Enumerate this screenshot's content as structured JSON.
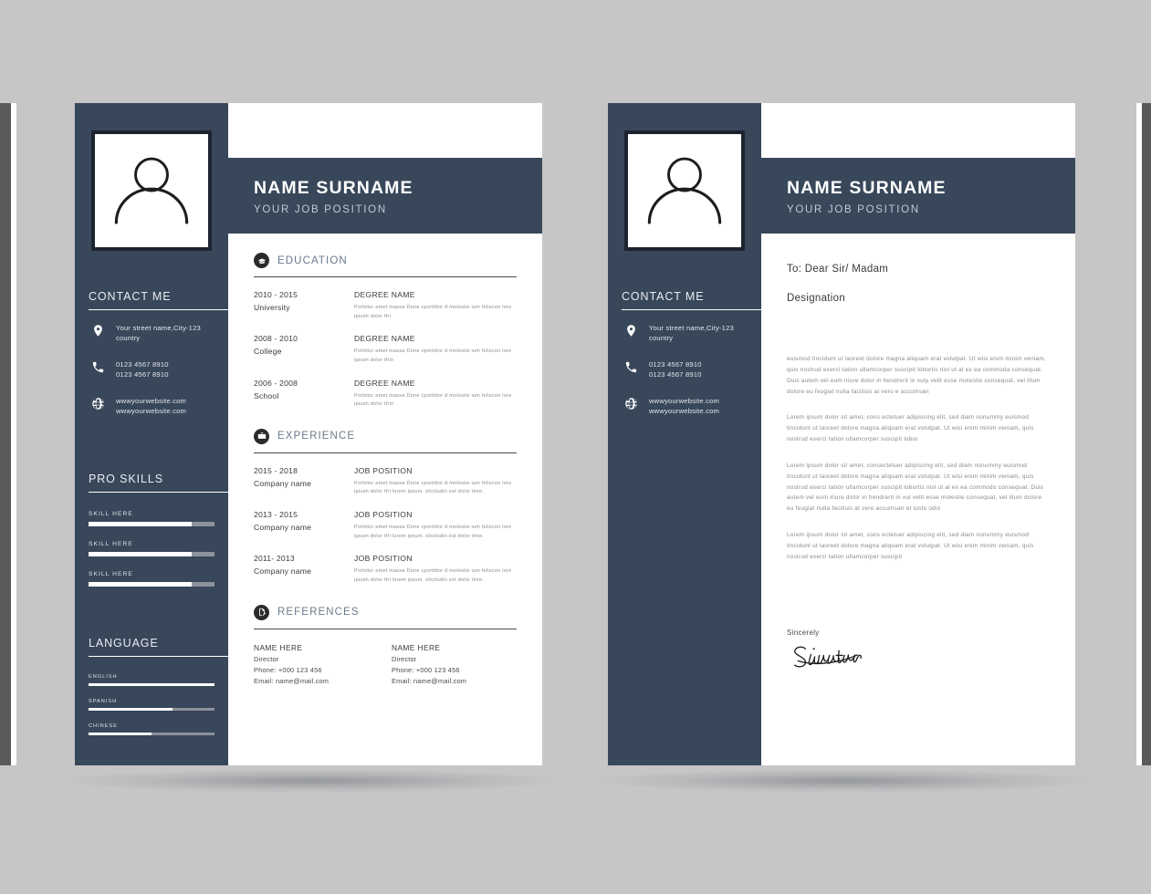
{
  "theme": {
    "navy": "#38475a",
    "page_bg": "#c6c6c6",
    "paper": "#ffffff",
    "section_heading": "#6a7a8d",
    "bar_track": "#8d929b",
    "bar_fill": "#ffffff",
    "body_text": "#8a8a8a"
  },
  "header": {
    "name": "NAME SURNAME",
    "job_position": "YOUR JOB POSITION"
  },
  "sidebar": {
    "avatar_icon": "person-avatar-icon",
    "contact": {
      "title": "CONTACT ME",
      "items": [
        {
          "icon": "location-pin-icon",
          "line1": "Your street name,City-123",
          "line2": "country"
        },
        {
          "icon": "phone-icon",
          "line1": "0123 4567 8910",
          "line2": "0123 4567 8910"
        },
        {
          "icon": "globe-icon",
          "line1": "wwwyourwebsite.com",
          "line2": "wwwyourwebsite.com"
        }
      ]
    },
    "pro_skills": {
      "title": "PRO SKILLS",
      "items": [
        {
          "label": "SKILL HERE",
          "value": 82
        },
        {
          "label": "SKILL HERE",
          "value": 82
        },
        {
          "label": "SKILL HERE",
          "value": 82
        }
      ]
    },
    "language": {
      "title": "LANGUAGE",
      "items": [
        {
          "label": "ENGLISH",
          "value": 100
        },
        {
          "label": "SPANISH",
          "value": 67
        },
        {
          "label": "CHINESE",
          "value": 50
        }
      ]
    }
  },
  "education": {
    "title": "EDUCATION",
    "icon": "graduation-cap-icon",
    "entries": [
      {
        "date": "2010 - 2015",
        "place": "University",
        "title": "DEGREE NAME",
        "desc": "Porttitor amet massa Done cporttitor d molestie ium feliscon lore ipsum dolor tfri"
      },
      {
        "date": "2008 - 2010",
        "place": "College",
        "title": "DEGREE NAME",
        "desc": "Porttitor amet massa Done cporttitor d molestie ium feliscon lore ipsum dolor tfrin"
      },
      {
        "date": "2006 - 2008",
        "place": "School",
        "title": "DEGREE NAME",
        "desc": "Porttitor amet massa Done cporttitor d molestie ium feliscon lore ipsum dolor tfrin"
      }
    ]
  },
  "experience": {
    "title": "EXPERIENCE",
    "icon": "briefcase-icon",
    "entries": [
      {
        "date": "2015 - 2018",
        "place": "Company name",
        "title": "JOB POSITION",
        "desc": "Porttitor amet massa Done cporttitor d molestie ium feliscon lore ipsum dolor tfri lorem ipsum. olicitudin est dolor time."
      },
      {
        "date": "2013 - 2015",
        "place": "Company name",
        "title": "JOB POSITION",
        "desc": "Porttitor amet massa Done cporttitor d molestie ium feliscon lore ipsum dolor tfri lorem ipsum. olicitudin est dolor time."
      },
      {
        "date": "2011- 2013",
        "place": "Company name",
        "title": "JOB POSITION",
        "desc": "Porttitor amet massa Done cporttitor d molestie ium feliscon lore ipsum dolor tfri lorem ipsum. olicitudin est dolor time."
      }
    ]
  },
  "references": {
    "title": "REFERENCES",
    "icon": "document-pen-icon",
    "entries": [
      {
        "name": "NAME  HERE",
        "role": "Director",
        "phone": "Phone: +000 123 456",
        "email": "Email: name@mail.com"
      },
      {
        "name": "NAME  HERE",
        "role": "Director",
        "phone": "Phone: +000 123 456",
        "email": "Email: name@mail.com"
      }
    ]
  },
  "cover_letter": {
    "to": "To: Dear Sir/ Madam",
    "designation": "Designation",
    "paragraphs": [
      "euismod tincidunt ut laoreet dolore magna aliquam erat volutpat. Ut wisi enim minim veniam, quis nostrud exerci tation ullamcorper suscipit lobortis nisl ut al ex ea commoda consequat. Duis autem vel eum iriure dolor in hendrerit in vulp velit esse molestie consequat, vel illum dolore eu feugiat nulla facilisis at vero e accumsan",
      "Lorem ipsum dolor sit amet, cons ectetuer adipiscing elit, sed diam nonummy euismod tincidunt ut laoreet dolore magna aliquam erat volutpat. Ut wisi enim minim veniam, quis nostrud exerci tation ullamcorper suscipit lobor",
      "Lorem ipsum dolor sit amet, consectetuer adipiscing elit, sed diam nonummy euismod tincidunt ut laoreet dolore magna aliquam erat volutpat. Ut wisi enim minim veniam, quis nostrud exerci tation ullamcorper suscipit lobortis nisl ut al ex ea commodo consequat. Duis autem vel eum iriure dolor in hendrerit in vul velit esse molestie consequat, vel illum dolore eu feugiat nulla facilisis at vero accumsan et iusto odio",
      "Lorem ipsum dolor sit amet, cons ectetuer adipiscing elit, sed diam nonummy euismod tincidunt ut laoreet dolore magna aliquam erat volutpat. Ut wisi enim minim veniam, quis nostrud exerci tation ullamcorper suscipit"
    ],
    "sign_label": "Sincerely",
    "signature_text": "Signature"
  }
}
